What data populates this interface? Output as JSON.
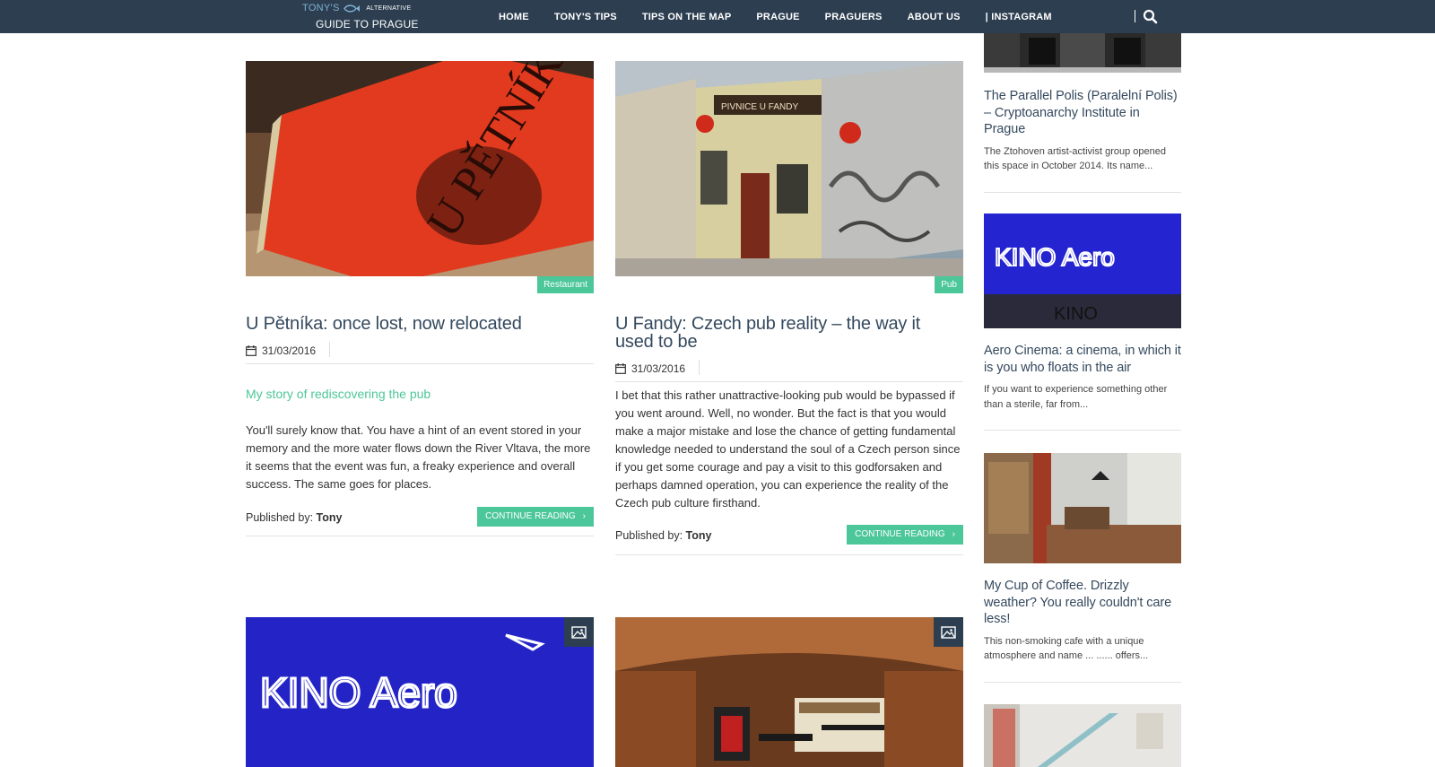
{
  "header": {
    "logo_top": "TONY'S",
    "logo_alt": "ALTERNATIVE",
    "logo_bottom": "GUIDE TO PRAGUE",
    "nav": [
      "HOME",
      "TONY'S TIPS",
      "TIPS ON THE MAP",
      "PRAGUE",
      "PRAGUERS",
      "ABOUT US",
      "| INSTAGRAM"
    ]
  },
  "posts": [
    {
      "category": "Restaurant",
      "title": "U Pětníka: once lost, now relocated",
      "date": "31/03/2016",
      "subtitle": "My story of rediscovering the pub",
      "excerpt": "You'll surely know that. You have a hint of an event stored in your memory and the more water flows down the River Vltava, the more it seems that the event was fun, a freaky experience and overall success. The same goes for places.",
      "published_label": "Published by:",
      "author": "Tony",
      "cta": "CONTINUE READING",
      "image_sign_text": "U PĚTNÍKA"
    },
    {
      "category": "Pub",
      "title": "U Fandy: Czech pub reality – the way it used to be",
      "date": "31/03/2016",
      "excerpt": "I bet that this rather unattractive-looking pub would be bypassed if you went around. Well, no wonder. But the fact is that you would make a major mistake and lose the chance of getting fundamental knowledge needed to understand the soul of a Czech person since if you get some courage and pay a visit to this godforsaken and perhaps damned operation, you can experience the reality of the Czech pub culture firsthand.",
      "published_label": "Published by:",
      "author": "Tony",
      "cta": "CONTINUE READING",
      "image_sign_text": "PIVNICE U FANDY"
    }
  ],
  "lower_posts": [
    {
      "image_sign_text": "KINO Aero"
    },
    {
      "image_sign_text": ""
    }
  ],
  "sidebar": [
    {
      "title": "The Parallel Polis (Paralelní Polis) – Cryptoanarchy Institute in Prague",
      "text": "The Ztohoven artist-activist group opened this space in October 2014. Its name..."
    },
    {
      "title": "Aero Cinema: a cinema, in which it is you who floats in the air",
      "text": "If you want to experience something other than a sterile, far from...",
      "image_sign_text": "KINO Aero",
      "image_sign_sub": "KINO"
    },
    {
      "title": "My Cup of Coffee. Drizzly weather? You really couldn't care less!",
      "text": "This non-smoking cafe with a unique atmosphere and name ... ...... offers..."
    }
  ],
  "colors": {
    "nav_bg": "#2c3e50",
    "accent": "#4cc799",
    "title": "#34495e"
  }
}
